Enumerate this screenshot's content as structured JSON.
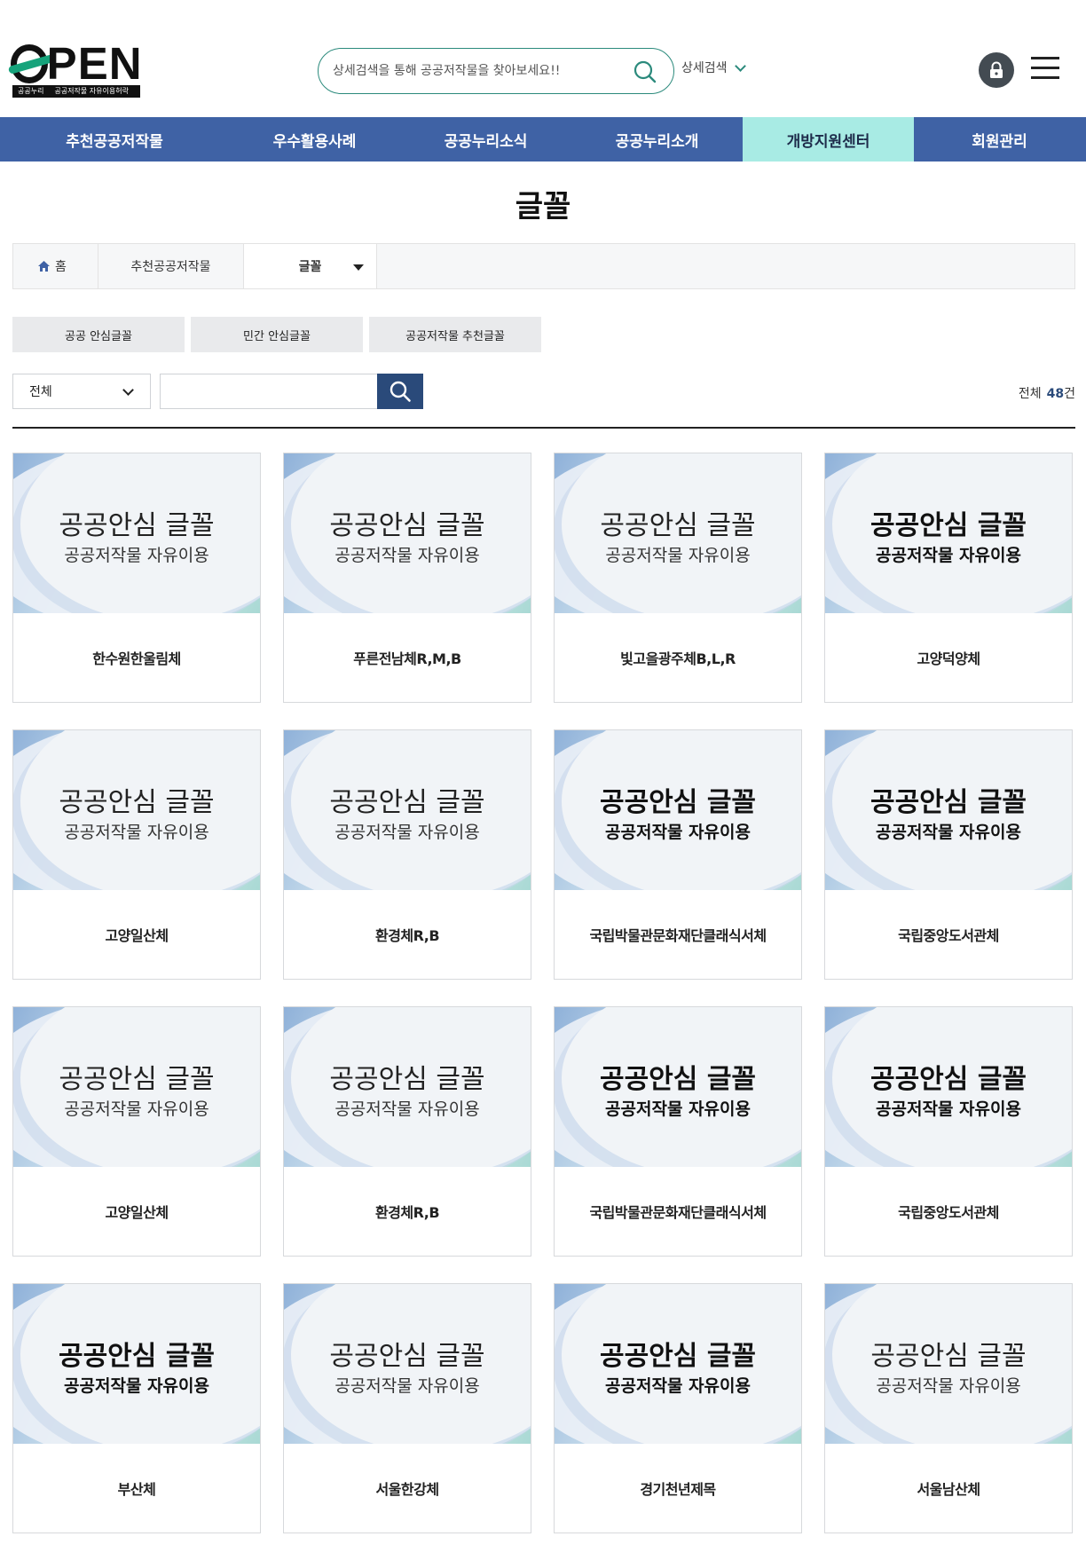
{
  "header": {
    "logo_text": "OPEN",
    "logo_sub_left": "공공누리",
    "logo_sub_right": "공공저작물 자유이용허락",
    "search_placeholder": "상세검색을 통해 공공저작물을 찾아보세요!!",
    "advanced_search_label": "상세검색"
  },
  "nav": {
    "items": [
      {
        "label": "추천공공저작물"
      },
      {
        "label": "우수활용사례"
      },
      {
        "label": "공공누리소식"
      },
      {
        "label": "공공누리소개"
      },
      {
        "label": "개방지원센터"
      },
      {
        "label": "회원관리"
      }
    ],
    "active_index": 4
  },
  "page": {
    "title": "글꼴"
  },
  "breadcrumb": {
    "home": "홈",
    "section": "추천공공저작물",
    "current": "글꼴"
  },
  "category_tabs": [
    {
      "label": "공공 안심글꼴"
    },
    {
      "label": "민간 안심글꼴"
    },
    {
      "label": "공공저작물 추천글꼴"
    }
  ],
  "filter": {
    "select_value": "전체",
    "keyword_value": ""
  },
  "count": {
    "prefix": "전체",
    "number": "48",
    "suffix": "건"
  },
  "thumb_text": {
    "line1": "공공안심 글꼴",
    "line2": "공공저작물 자유이용"
  },
  "fonts": [
    {
      "name": "한수원한울림체",
      "style": "normal"
    },
    {
      "name": "푸른전남체R,M,B",
      "style": "normal"
    },
    {
      "name": "빛고을광주체B,L,R",
      "style": "normal"
    },
    {
      "name": "고양덕양체",
      "style": "bold"
    },
    {
      "name": "고양일산체",
      "style": "normal"
    },
    {
      "name": "환경체R,B",
      "style": "normal"
    },
    {
      "name": "국립박물관문화재단클래식서체",
      "style": "bold"
    },
    {
      "name": "국립중앙도서관체",
      "style": "bold"
    },
    {
      "name": "고양일산체",
      "style": "normal"
    },
    {
      "name": "환경체R,B",
      "style": "normal"
    },
    {
      "name": "국립박물관문화재단클래식서체",
      "style": "bold"
    },
    {
      "name": "국립중앙도서관체",
      "style": "bold"
    },
    {
      "name": "부산체",
      "style": "bold"
    },
    {
      "name": "서울한강체",
      "style": "serif"
    },
    {
      "name": "경기천년제목",
      "style": "bold"
    },
    {
      "name": "서울남산체",
      "style": "normal"
    }
  ],
  "colors": {
    "nav_bg": "#3f62a5",
    "nav_active_bg": "#a8ebe4",
    "accent": "#2b8a7c",
    "search_button_bg": "#2a4a7a"
  }
}
